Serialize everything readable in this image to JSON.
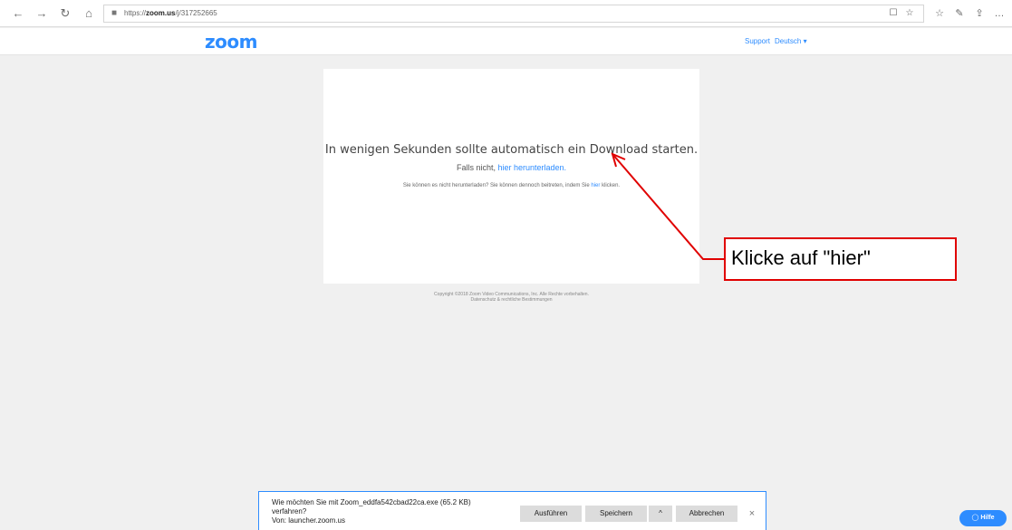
{
  "browser": {
    "url_prefix": "https://",
    "url_domain": "zoom.us",
    "url_path": "/j/317252665",
    "icons": {
      "back": "←",
      "forward": "→",
      "refresh": "↻",
      "home": "⌂",
      "lock": "🔒",
      "reading_view": "☐",
      "favorite": "☆",
      "favorites_bar": "☆",
      "pen": "✎",
      "share": "⇪",
      "more": "…"
    }
  },
  "header": {
    "logo": "zoom",
    "support": "Support",
    "language": "Deutsch ▾"
  },
  "card": {
    "main_message": "In wenigen Sekunden sollte automatisch ein Download starten.",
    "fallback_prefix": "Falls nicht, ",
    "fallback_link": "hier herunterladen.",
    "alt_prefix": "Sie können es nicht herunterladen? Sie können dennoch beitreten, indem Sie ",
    "alt_link": "hier",
    "alt_suffix": " klicken."
  },
  "footer": {
    "copyright": "Copyright ©2018 Zoom Video Communications, Inc. Alle Rechte vorbehalten.",
    "links": "Datenschutz & rechtliche Bestimmungen"
  },
  "annotation": {
    "text": "Klicke auf \"hier\"",
    "color": "#e00000"
  },
  "download": {
    "question_line1": "Wie möchten Sie mit Zoom_eddfa542cbad22ca.exe (65.2 KB)",
    "question_line2": "verfahren?",
    "source": "Von: launcher.zoom.us",
    "run": "Ausführen",
    "save": "Speichern",
    "save_options": "^",
    "cancel": "Abbrechen",
    "close": "×"
  },
  "help": {
    "label": "Hilfe",
    "icon": "◯"
  },
  "colors": {
    "accent": "#2d8cff",
    "background": "#f0f0f0"
  }
}
